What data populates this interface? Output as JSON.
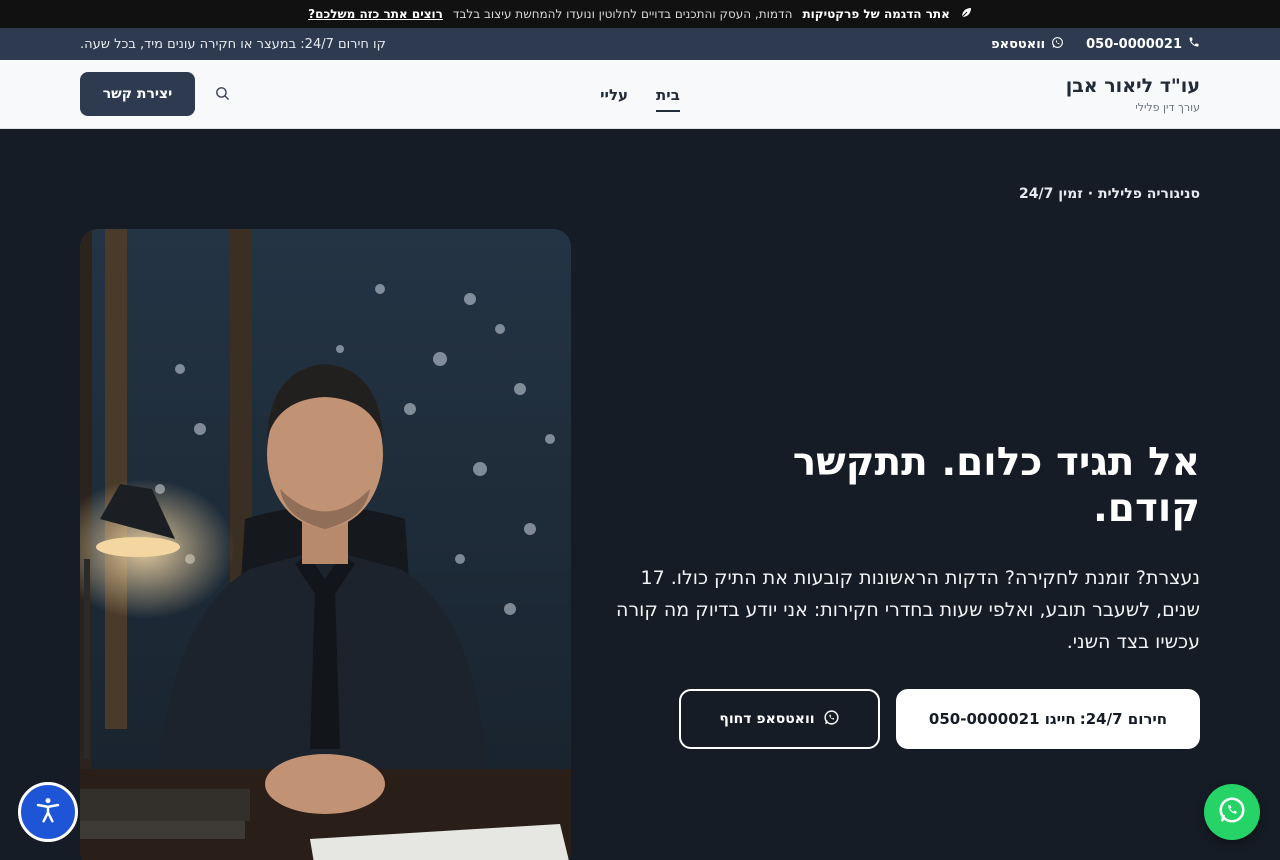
{
  "demo_bar": {
    "icon": "leaf-icon",
    "title": "אתר הדגמה של פרקטיקות",
    "note": "הדמות, העסק והתכנים בדויים לחלוטין ונועדו להמחשת עיצוב בלבד",
    "cta": "רוצים אתר כזה משלכם?"
  },
  "contact_bar": {
    "phone": "050-0000021",
    "phone_icon": "phone-icon",
    "whatsapp": "וואטסאפ",
    "whatsapp_icon": "whatsapp-icon",
    "hotline_note": "קו חירום 24/7: במעצר או חקירה עונים מיד, בכל שעה."
  },
  "header": {
    "brand_name": "עו\"ד ליאור אבן",
    "brand_sub": "עורך דין פלילי",
    "nav": [
      "בית",
      "עליי"
    ],
    "active_nav": "בית",
    "search_icon": "search-icon",
    "contact_button": "יצירת קשר"
  },
  "hero": {
    "eyebrow": "סניגוריה פלילית · זמין 24/7",
    "headline": "אל תגיד כלום. תתקשר קודם.",
    "lead": "נעצרת? זומנת לחקירה? הדקות הראשונות קובעות את התיק כולו. 17 שנים, לשעבר תובע, ואלפי שעות בחדרי חקירות: אני יודע בדיוק מה קורה עכשיו בצד השני.",
    "primary_cta_prefix": "חירום 24/7:",
    "primary_cta_suffix": "חייגו 050-0000021",
    "secondary_cta": "וואטסאפ דחוף",
    "secondary_cta_icon": "whatsapp-icon"
  },
  "floating": {
    "accessibility_icon": "accessibility-icon",
    "whatsapp_icon": "whatsapp-icon"
  },
  "colors": {
    "page_bg": "#161c26",
    "contact_bar_bg": "#2d3a4f",
    "header_bg": "#f8f9fb",
    "accessibility_bg": "#1e55d6",
    "whatsapp_green": "#25d366"
  }
}
